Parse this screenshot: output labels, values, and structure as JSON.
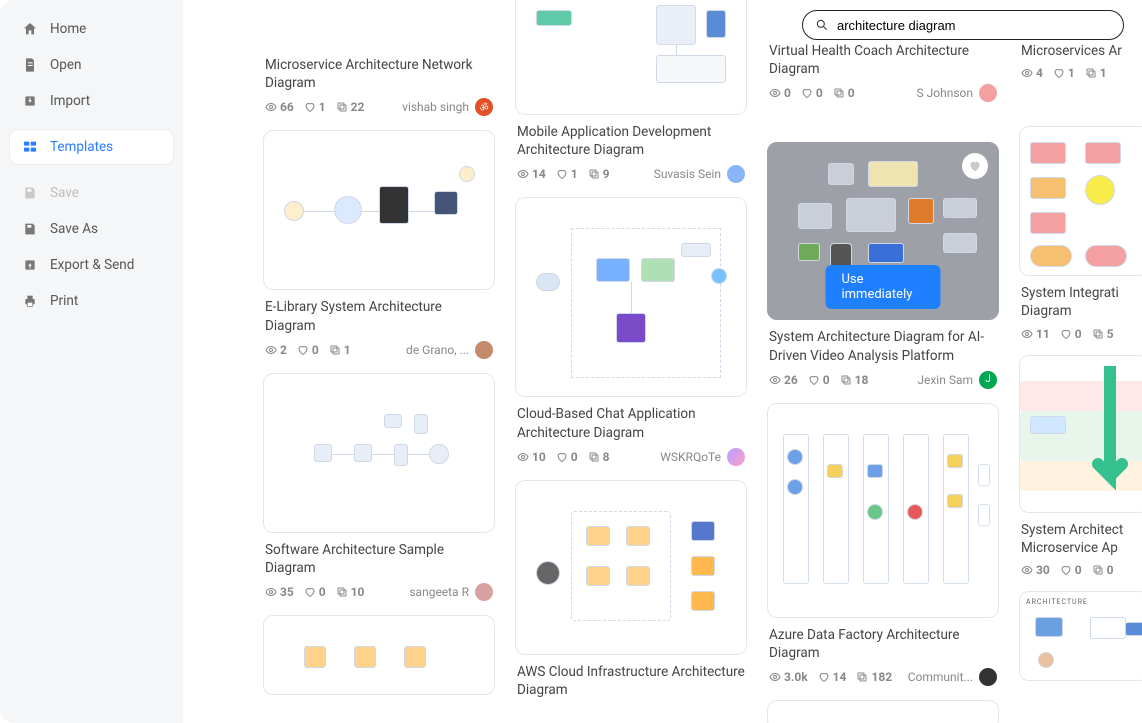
{
  "search": {
    "value": "architecture diagram"
  },
  "nav": {
    "home": "Home",
    "open": "Open",
    "import": "Import",
    "templates": "Templates",
    "save": "Save",
    "save_as": "Save As",
    "export": "Export & Send",
    "print": "Print"
  },
  "cta": {
    "use_immediately": "Use immediately"
  },
  "cards": {
    "c1": {
      "title": "Microservice Architecture Network Diagram",
      "views": "66",
      "likes": "1",
      "copies": "22",
      "author": "vishab singh",
      "avatar_bg": "#e34f26",
      "avatar_tx": "ॐ"
    },
    "c2": {
      "title": "E-Library System Architecture Diagram",
      "views": "2",
      "likes": "0",
      "copies": "1",
      "author": "de Grano, ...",
      "avatar_bg": "#c38b6a",
      "avatar_tx": ""
    },
    "c3": {
      "title": "Software Architecture Sample Diagram",
      "views": "35",
      "likes": "0",
      "copies": "10",
      "author": "sangeeta R",
      "avatar_bg": "#d8a0a0",
      "avatar_tx": ""
    },
    "c4": {
      "title": "Mobile Application Development Architecture Diagram",
      "views": "14",
      "likes": "1",
      "copies": "9",
      "author": "Suvasis Sein",
      "avatar_bg": "#8ab4f8",
      "avatar_tx": ""
    },
    "c5": {
      "title": "Cloud-Based Chat Application Architecture Diagram",
      "views": "10",
      "likes": "0",
      "copies": "8",
      "author": "WSKRQoTe",
      "avatar_bg": "#b5a0ff",
      "avatar_tx": ""
    },
    "c6": {
      "title": "AWS Cloud Infrastructure Architecture Diagram",
      "views": "",
      "likes": "",
      "copies": "",
      "author": "",
      "avatar_bg": "#ddd",
      "avatar_tx": ""
    },
    "c7": {
      "title": "Virtual Health Coach Architecture Diagram",
      "views": "0",
      "likes": "0",
      "copies": "0",
      "author": "S Johnson",
      "avatar_bg": "#f2a0a0",
      "avatar_tx": ""
    },
    "c8": {
      "title": "System Architecture Diagram for AI-Driven Video Analysis Platform",
      "views": "26",
      "likes": "0",
      "copies": "18",
      "author": "Jexin Sam",
      "avatar_bg": "#00a651",
      "avatar_tx": "J"
    },
    "c9": {
      "title": "Azure Data Factory Architecture Diagram",
      "views": "3.0k",
      "likes": "14",
      "copies": "182",
      "author": "Communit...",
      "avatar_bg": "#333",
      "avatar_tx": ""
    },
    "c10": {
      "title": "Microservices Ar",
      "views": "4",
      "likes": "1",
      "copies": "1",
      "author": "",
      "avatar_bg": "#ddd",
      "avatar_tx": ""
    },
    "c11": {
      "title": "System Integrati Diagram",
      "views": "11",
      "likes": "0",
      "copies": "5",
      "author": "",
      "avatar_bg": "#ddd",
      "avatar_tx": ""
    },
    "c12": {
      "title": "System Architect Microservice Ap",
      "views": "30",
      "likes": "0",
      "copies": "0",
      "author": "",
      "avatar_bg": "#ddd",
      "avatar_tx": ""
    }
  }
}
